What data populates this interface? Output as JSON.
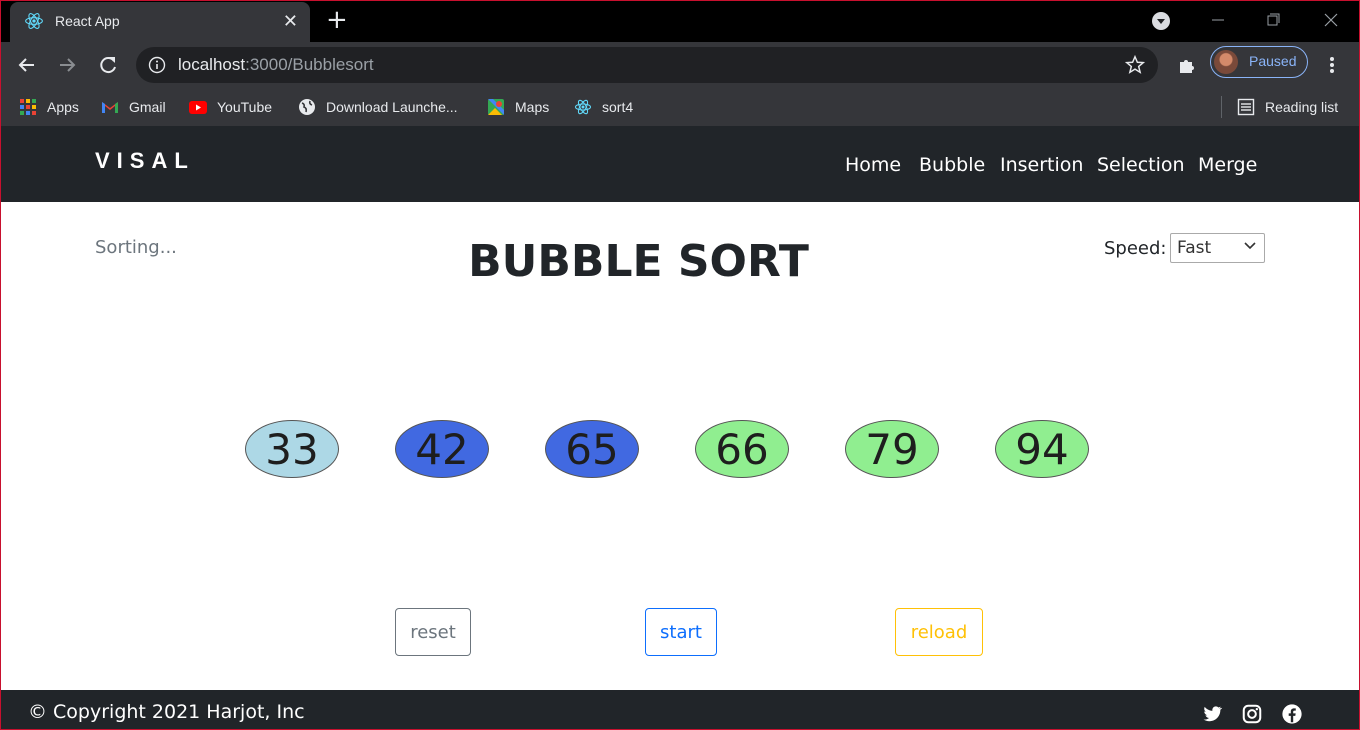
{
  "browser": {
    "tab_title": "React App",
    "url_host": "localhost",
    "url_path": ":3000/Bubblesort",
    "profile_label": "Paused",
    "bookmarks": [
      {
        "label": "Apps",
        "icon": "apps-grid-icon"
      },
      {
        "label": "Gmail",
        "icon": "gmail-icon"
      },
      {
        "label": "YouTube",
        "icon": "youtube-icon"
      },
      {
        "label": "Download Launche...",
        "icon": "globe-icon"
      },
      {
        "label": "Maps",
        "icon": "maps-icon"
      },
      {
        "label": "sort4",
        "icon": "react-icon"
      }
    ],
    "reading_list": "Reading list"
  },
  "nav": {
    "brand": "VISAL",
    "links": [
      "Home",
      "Bubble",
      "Insertion",
      "Selection",
      "Merge"
    ]
  },
  "main": {
    "status": "Sorting...",
    "title": "BUBBLE SORT",
    "speed_label": "Speed:",
    "speed_value": "Fast"
  },
  "bubbles": [
    {
      "value": "33",
      "color": "#add8e6"
    },
    {
      "value": "42",
      "color": "#4169e1"
    },
    {
      "value": "65",
      "color": "#4169e1"
    },
    {
      "value": "66",
      "color": "#90ee90"
    },
    {
      "value": "79",
      "color": "#90ee90"
    },
    {
      "value": "94",
      "color": "#90ee90"
    }
  ],
  "buttons": [
    {
      "label": "reset",
      "color": "#6c757d"
    },
    {
      "label": "start",
      "color": "#0d6efd"
    },
    {
      "label": "reload",
      "color": "#ffc107"
    }
  ],
  "footer": {
    "copyright": "© Copyright 2021 Harjot, Inc",
    "social": [
      "twitter-icon",
      "instagram-icon",
      "facebook-icon"
    ]
  }
}
